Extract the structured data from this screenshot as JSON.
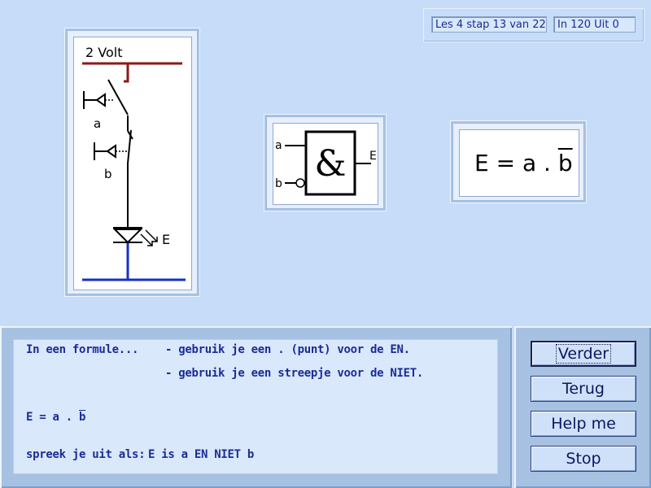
{
  "status": {
    "lesson": "Les 4 stap 13 van 22",
    "counter": "In  120 Uit  0"
  },
  "circuit": {
    "voltage_label": "2 Volt",
    "switch_a_label": "a",
    "switch_b_label": "b",
    "led_label": "E",
    "colors": {
      "supply": "#8b1a1a",
      "ground": "#1530c8",
      "wire": "#000000"
    }
  },
  "gate": {
    "symbol": "&",
    "input_a": "a",
    "input_b": "b",
    "output": "E"
  },
  "formula": {
    "lhs": "E = a . ",
    "var": "b"
  },
  "explanation": {
    "intro": "In een formule...",
    "rule1": "- gebruik je een . (punt) voor de EN.",
    "rule2": "- gebruik je een streepje voor de NIET.",
    "formula_lhs": "E = a . ",
    "formula_var": "b",
    "pronounce_label": "spreek je uit als:",
    "pronounce_text": "E is a EN NIET b"
  },
  "buttons": {
    "next": "Verder",
    "back": "Terug",
    "help": "Help me",
    "stop": "Stop"
  }
}
